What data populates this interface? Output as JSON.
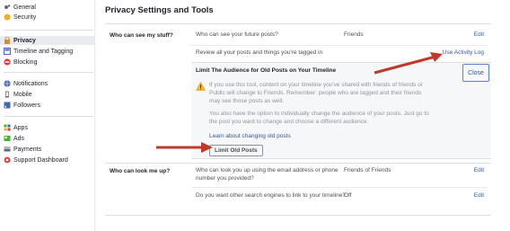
{
  "sidebar": {
    "items": [
      {
        "label": "General",
        "icon": "gear-icon",
        "active": false
      },
      {
        "label": "Security",
        "icon": "badge-icon",
        "active": false
      },
      {
        "label": "Privacy",
        "icon": "lock-icon",
        "active": true
      },
      {
        "label": "Timeline and Tagging",
        "icon": "timeline-icon",
        "active": false
      },
      {
        "label": "Blocking",
        "icon": "block-icon",
        "active": false
      },
      {
        "label": "Notifications",
        "icon": "globe-icon",
        "active": false
      },
      {
        "label": "Mobile",
        "icon": "mobile-icon",
        "active": false
      },
      {
        "label": "Followers",
        "icon": "rss-icon",
        "active": false
      },
      {
        "label": "Apps",
        "icon": "apps-icon",
        "active": false
      },
      {
        "label": "Ads",
        "icon": "ads-icon",
        "active": false
      },
      {
        "label": "Payments",
        "icon": "card-icon",
        "active": false
      },
      {
        "label": "Support Dashboard",
        "icon": "lifebuoy-icon",
        "active": false
      }
    ]
  },
  "main": {
    "title": "Privacy Settings and Tools",
    "sections": [
      {
        "label": "Who can see my stuff?",
        "rows": [
          {
            "question": "Who can see your future posts?",
            "value": "Friends",
            "action": "Edit"
          },
          {
            "question": "Review all your posts and things you're tagged in",
            "value": "",
            "action": "Use Activity Log"
          }
        ]
      },
      {
        "label": "Who can look me up?",
        "rows": [
          {
            "question": "Who can look you up using the email address or phone number you provided?",
            "value": "Friends of Friends",
            "action": "Edit"
          },
          {
            "question": "Do you want other search engines to link to your timeline?",
            "value": "Off",
            "action": "Edit"
          }
        ]
      }
    ],
    "limit_panel": {
      "title": "Limit The Audience for Old Posts on Your Timeline",
      "warning": "If you use this tool, content on your timeline you've shared with friends of friends or Public will change to Friends. Remember: people who are tagged and their friends may see those posts as well.",
      "info": "You also have the option to individually change the audience of your posts. Just go to the post you want to change and choose a different audience.",
      "link": "Learn about changing old posts",
      "button": "Limit Old Posts",
      "close": "Close"
    }
  },
  "colors": {
    "link": "#365899",
    "arrow": "#c0392b",
    "warning": "#f7b928"
  }
}
